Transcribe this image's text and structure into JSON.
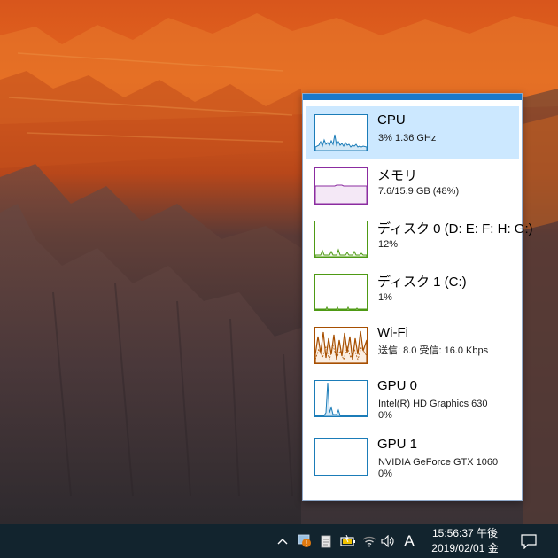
{
  "summary_panel": {
    "items": [
      {
        "title": "CPU",
        "detail": "3%  1.36 GHz",
        "color": "#1b7cb8",
        "selected": true
      },
      {
        "title": "メモリ",
        "detail": "7.6/15.9 GB (48%)",
        "color": "#8b2ca0"
      },
      {
        "title": "ディスク 0 (D: E: F: H: G:)",
        "detail": "12%",
        "color": "#4e9a14"
      },
      {
        "title": "ディスク 1 (C:)",
        "detail": "1%",
        "color": "#4e9a14"
      },
      {
        "title": "Wi-Fi",
        "detail": "送信: 8.0 受信: 16.0 Kbps",
        "color": "#a74f01"
      },
      {
        "title": "GPU 0",
        "detail": "Intel(R) HD Graphics 630",
        "detail2": "0%",
        "color": "#1b7cb8"
      },
      {
        "title": "GPU 1",
        "detail": "NVIDIA GeForce GTX 1060",
        "detail2": "0%",
        "color": "#1b7cb8"
      }
    ]
  },
  "taskbar": {
    "tray_icons": [
      "chevron-up-icon",
      "task-manager-tray-icon",
      "document-icon",
      "battery-icon",
      "wifi-icon",
      "volume-icon"
    ],
    "ime_mode": "A",
    "time": "15:56:37 午後",
    "date": "2019/02/01 金",
    "notification_icon": "action-center-icon"
  }
}
